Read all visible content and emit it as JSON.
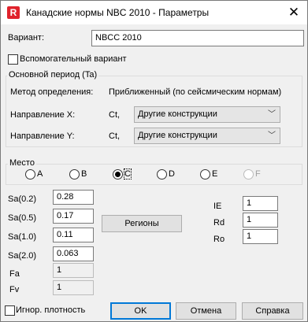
{
  "window": {
    "title": "Канадские нормы NBC 2010 - Параметры",
    "app_icon_letter": "R",
    "close_glyph": "✕"
  },
  "variant": {
    "label": "Вариант:",
    "value": "NBCC 2010"
  },
  "auxiliary": {
    "label": "Вспомогательный вариант",
    "checked": false
  },
  "main_period": {
    "group_label": "Основной период (Ta)",
    "method_label": "Метод определения:",
    "method_value": "Приближенный (по сейсмическим нормам)",
    "dir_x": {
      "label": "Направление X:",
      "unit": "Ct,",
      "value": "Другие конструкции"
    },
    "dir_y": {
      "label": "Направление Y:",
      "unit": "Ct,",
      "value": "Другие конструкции"
    }
  },
  "site": {
    "group_label": "Место",
    "options": [
      {
        "label": "A",
        "selected": false,
        "enabled": true
      },
      {
        "label": "B",
        "selected": false,
        "enabled": true
      },
      {
        "label": "C",
        "selected": true,
        "enabled": true
      },
      {
        "label": "D",
        "selected": false,
        "enabled": true
      },
      {
        "label": "E",
        "selected": false,
        "enabled": true
      },
      {
        "label": "F",
        "selected": false,
        "enabled": false
      }
    ]
  },
  "sa": [
    {
      "label": "Sa(0.2)",
      "value": "0.28"
    },
    {
      "label": "Sa(0.5)",
      "value": "0.17"
    },
    {
      "label": "Sa(1.0)",
      "value": "0.11"
    },
    {
      "label": "Sa(2.0)",
      "value": "0.063"
    }
  ],
  "fa": {
    "label": "Fa",
    "value": "1"
  },
  "fv": {
    "label": "Fv",
    "value": "1"
  },
  "regions_button": "Регионы",
  "factors": [
    {
      "label": "IE",
      "value": "1"
    },
    {
      "label": "Rd",
      "value": "1"
    },
    {
      "label": "Ro",
      "value": "1"
    }
  ],
  "ignore_density": {
    "label": "Игнор. плотность",
    "checked": false
  },
  "buttons": {
    "ok": "OK",
    "cancel": "Отмена",
    "help": "Справка"
  }
}
